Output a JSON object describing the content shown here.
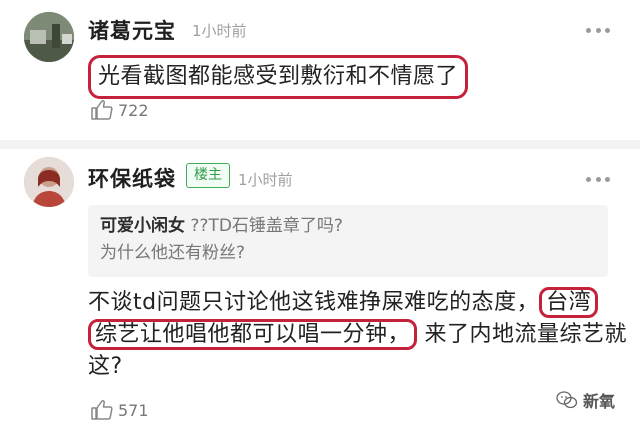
{
  "comments": [
    {
      "username": "诸葛元宝",
      "time": "1小时前",
      "text": "光看截图都能感受到敷衍和不情愿了",
      "likes": "722",
      "avatar_icon": "landscape-avatar"
    },
    {
      "username": "环保纸袋",
      "badge": "楼主",
      "time": "1小时前",
      "quote_user": "可爱小闲女",
      "quote_line1": "??TD石锤盖章了吗?",
      "quote_line2": "为什么他还有粉丝?",
      "reply_part1": "不谈td问题只讨论他这钱难挣屎难吃的态度，",
      "reply_hl1": "台湾",
      "reply_hl2": "综艺让他唱他都可以唱一分钟，",
      "reply_part2": "来了内地流量综艺就这?",
      "likes": "571",
      "avatar_icon": "portrait-avatar"
    }
  ],
  "watermark": {
    "text": "新氧",
    "icon": "wechat-icon"
  },
  "colors": {
    "highlight": "#c4223a",
    "badge": "#2f9e4c"
  }
}
